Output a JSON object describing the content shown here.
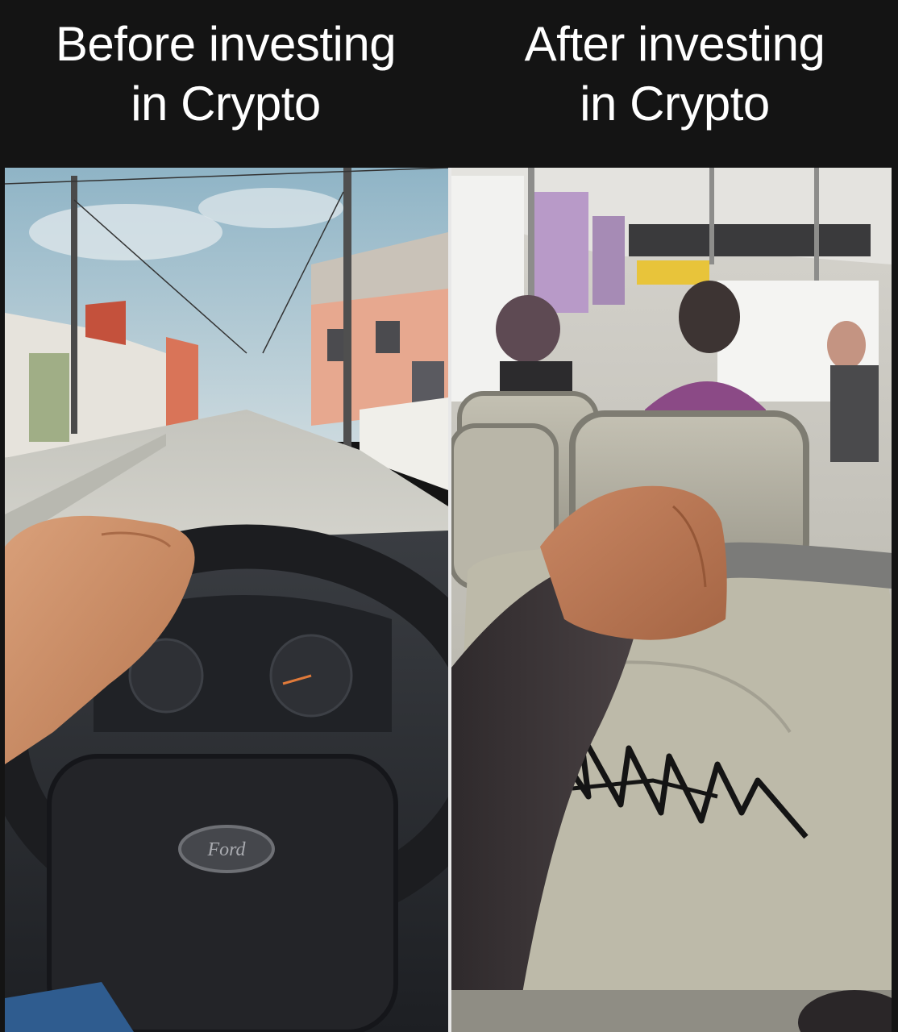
{
  "captions": {
    "left": {
      "line1": "Before investing",
      "line2": "in Crypto"
    },
    "right": {
      "line1": "After investing",
      "line2": "in Crypto"
    }
  },
  "panels": {
    "left": {
      "steering_logo": "Ford"
    }
  },
  "colors": {
    "background": "#141414",
    "caption_text": "#ffffff",
    "sky": "#a9c3cf",
    "road": "#cfcfc9",
    "dashboard": "#2b2d31",
    "skin": "#c98a64",
    "bus_seat": "#b5b2a4",
    "grab_bar": "#8a8a88"
  }
}
